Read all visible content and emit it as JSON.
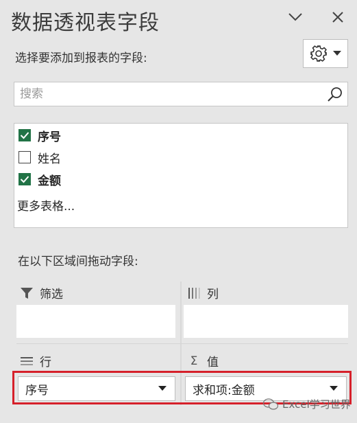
{
  "pane": {
    "title": "数据透视表字段",
    "header_icons": [
      "chevron-down-icon",
      "close-icon"
    ],
    "subtitle": "选择要添加到报表的字段:",
    "settings_icons": [
      "gear-icon",
      "dropdown-arrow-icon"
    ]
  },
  "search": {
    "placeholder": "搜索",
    "value": "",
    "icon": "search-icon"
  },
  "fields": [
    {
      "label": "序号",
      "checked": true
    },
    {
      "label": "姓名",
      "checked": false
    },
    {
      "label": "金额",
      "checked": true
    }
  ],
  "more_tables": "更多表格...",
  "drag_hint": "在以下区域间拖动字段:",
  "areas": {
    "filter": {
      "label": "筛选",
      "icon": "filter-icon"
    },
    "columns": {
      "label": "列",
      "icon": "columns-icon"
    },
    "rows": {
      "label": "行",
      "icon": "rows-icon",
      "items": [
        "序号"
      ]
    },
    "values": {
      "label": "值",
      "icon": "sigma-icon",
      "items": [
        "求和项:金额"
      ]
    }
  },
  "highlight_color": "#d6202a",
  "accent_color": "#217346",
  "watermark": "Excel学习世界"
}
